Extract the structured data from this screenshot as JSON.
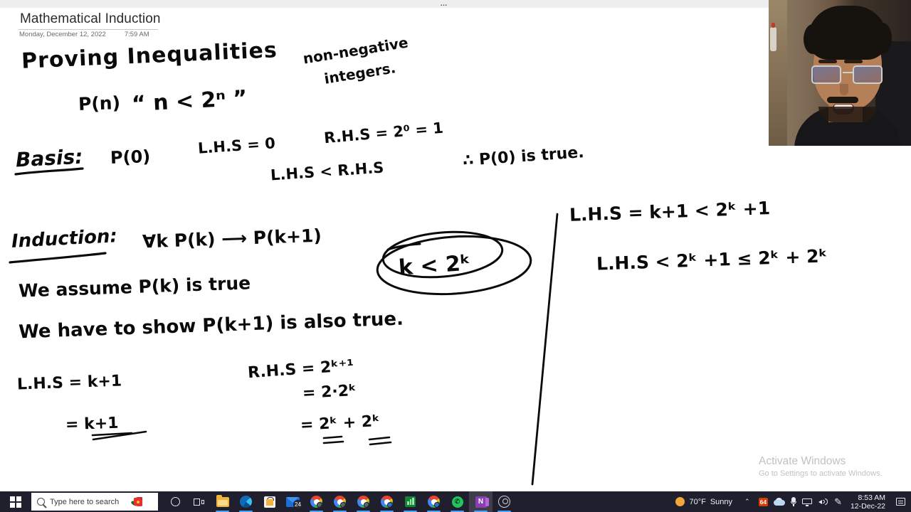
{
  "app": {
    "name": "onenote",
    "overflow_menu": "…"
  },
  "page": {
    "title": "Mathematical Induction",
    "date": "Monday, December 12, 2022",
    "time": "7:59 AM"
  },
  "ink_notes": {
    "heading": "Proving Inequalities",
    "predicate": "P(n)",
    "predicate_quote": "“ n < 2ⁿ ”",
    "domain_line1": "non-negative",
    "domain_line2": "integers.",
    "basis_label": "Basis:",
    "basis_pred": "P(0)",
    "basis_lhs": "L.H.S = 0",
    "basis_rhs": "R.H.S = 2⁰ = 1",
    "basis_compare": "L.H.S < R.H.S",
    "basis_conclusion": "∴ P(0) is true.",
    "induction_label": "Induction:",
    "induction_statement": "∀k   P(k) ⟶ P(k+1)",
    "assume_line": "We assume P(k) is true",
    "circled_hypothesis": "k < 2ᵏ",
    "show_line": "We have to show  P(k+1) is also true.",
    "lhs_line1": "L.H.S =  k+1",
    "lhs_line2": "=  k+1",
    "rhs_line1": "R.H.S =  2ᵏ⁺¹",
    "rhs_line2": "= 2·2ᵏ",
    "rhs_line3": "= 2ᵏ + 2ᵏ",
    "right_line1": "L.H.S  =  k+1 < 2ᵏ +1",
    "right_line2": "L.H.S  <  2ᵏ +1 ≤ 2ᵏ + 2ᵏ"
  },
  "watermark": {
    "title": "Activate Windows",
    "subtitle": "Go to Settings to activate Windows."
  },
  "taskbar": {
    "start": "start-button",
    "search_placeholder": "Type here to search",
    "items": [
      {
        "name": "cortana",
        "label": "Cortana",
        "active": false
      },
      {
        "name": "task-view",
        "label": "Task View",
        "active": false
      },
      {
        "name": "file-explorer",
        "label": "File Explorer",
        "active": false,
        "open": true
      },
      {
        "name": "edge",
        "label": "Microsoft Edge",
        "active": false,
        "open": true
      },
      {
        "name": "store",
        "label": "Microsoft Store",
        "active": false
      },
      {
        "name": "mail",
        "label": "Mail",
        "active": false,
        "badge": "24"
      },
      {
        "name": "chrome-1",
        "label": "Google Chrome",
        "active": false,
        "open": true
      },
      {
        "name": "chrome-2",
        "label": "Google Chrome",
        "active": false,
        "open": true
      },
      {
        "name": "chrome-3",
        "label": "Google Chrome",
        "active": false,
        "open": true
      },
      {
        "name": "chrome-4",
        "label": "Google Chrome",
        "active": false,
        "open": true
      },
      {
        "name": "sheets",
        "label": "Google Sheets",
        "active": false,
        "open": true
      },
      {
        "name": "chrome-5",
        "label": "Google Chrome",
        "active": false,
        "open": true
      },
      {
        "name": "whatsapp",
        "label": "WhatsApp",
        "active": false,
        "open": true
      },
      {
        "name": "onenote",
        "label": "OneNote",
        "active": true,
        "open": true
      },
      {
        "name": "obs",
        "label": "OBS Studio",
        "active": false,
        "open": true
      }
    ],
    "tray": {
      "weather_temp": "70°F",
      "weather_condition": "Sunny",
      "chevron": "⌃",
      "badge_count": "64",
      "time": "8:53 AM",
      "date": "12-Dec-22"
    }
  },
  "colors": {
    "taskbar_bg": "#1f1f2e",
    "accent": "#4aa3ff",
    "ink": "#0a0a0a",
    "badge_red": "#d83b01",
    "watermark": "#c2c2c2"
  }
}
